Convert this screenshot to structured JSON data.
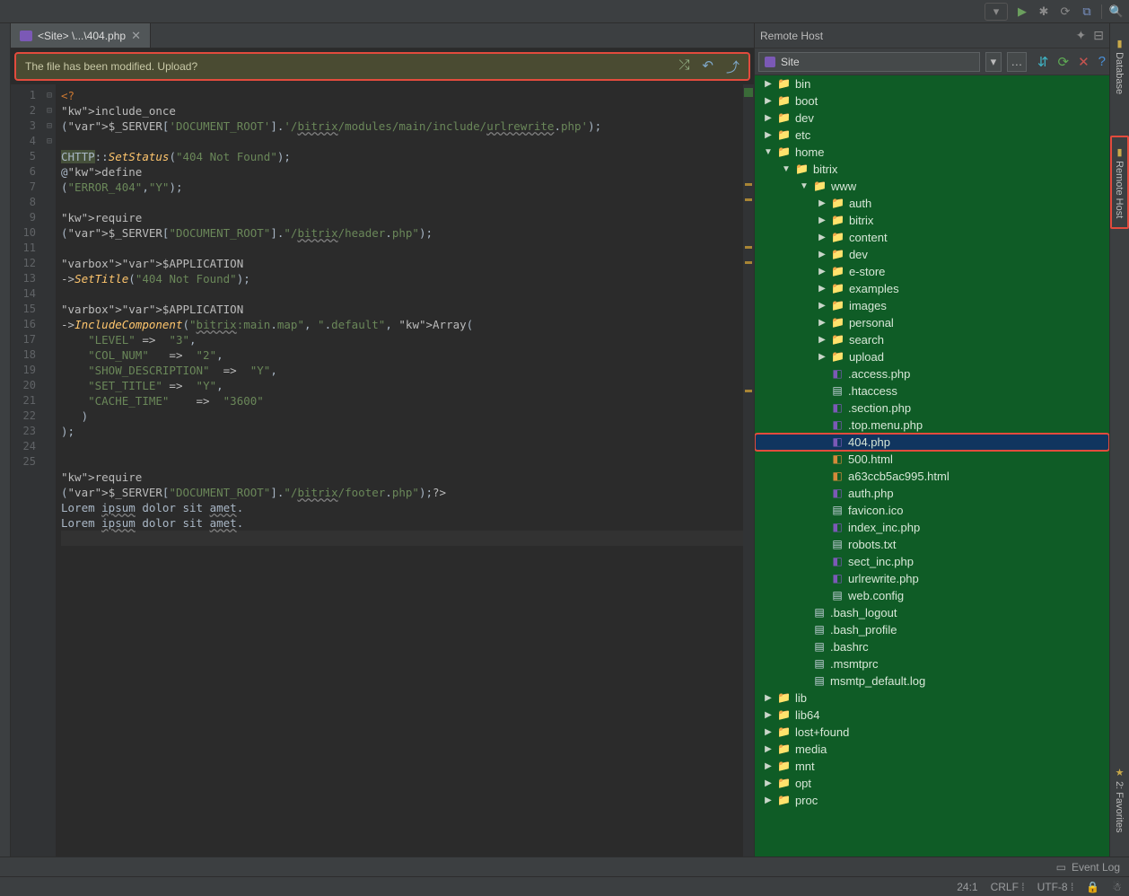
{
  "tab": {
    "label": "<Site> \\...\\404.php"
  },
  "notification": {
    "text": "The file has been modified. Upload?"
  },
  "code_lines": [
    "<?",
    "include_once($_SERVER['DOCUMENT_ROOT'].'/bitrix/modules/main/include/urlrewrite.php');",
    "",
    "CHTTP::SetStatus(\"404 Not Found\");",
    "@define(\"ERROR_404\",\"Y\");",
    "",
    "require($_SERVER[\"DOCUMENT_ROOT\"].\"/bitrix/header.php\");",
    "",
    "$APPLICATION->SetTitle(\"404 Not Found\");",
    "",
    "$APPLICATION->IncludeComponent(\"bitrix:main.map\", \".default\", Array(",
    "    \"LEVEL\" =>  \"3\",",
    "    \"COL_NUM\"   =>  \"2\",",
    "    \"SHOW_DESCRIPTION\"  =>  \"Y\",",
    "    \"SET_TITLE\" =>  \"Y\",",
    "    \"CACHE_TIME\"    =>  \"3600\"",
    "   )",
    ");",
    "",
    "",
    "require($_SERVER[\"DOCUMENT_ROOT\"].\"/bitrix/footer.php\");?>",
    "Lorem ipsum dolor sit amet.",
    "Lorem ipsum dolor sit amet.",
    "",
    ""
  ],
  "remote_host": {
    "title": "Remote Host"
  },
  "deployment": {
    "name": "Site"
  },
  "tree": [
    {
      "d": 0,
      "exp": false,
      "type": "folder",
      "name": "bin"
    },
    {
      "d": 0,
      "exp": false,
      "type": "folder",
      "name": "boot"
    },
    {
      "d": 0,
      "exp": false,
      "type": "folder",
      "name": "dev"
    },
    {
      "d": 0,
      "exp": false,
      "type": "folder",
      "name": "etc"
    },
    {
      "d": 0,
      "exp": true,
      "type": "folder",
      "name": "home"
    },
    {
      "d": 1,
      "exp": true,
      "type": "folder",
      "name": "bitrix"
    },
    {
      "d": 2,
      "exp": true,
      "type": "folder",
      "name": "www"
    },
    {
      "d": 3,
      "exp": false,
      "type": "folder",
      "name": "auth"
    },
    {
      "d": 3,
      "exp": false,
      "type": "folder",
      "name": "bitrix"
    },
    {
      "d": 3,
      "exp": false,
      "type": "folder",
      "name": "content"
    },
    {
      "d": 3,
      "exp": false,
      "type": "folder",
      "name": "dev"
    },
    {
      "d": 3,
      "exp": false,
      "type": "folder",
      "name": "e-store"
    },
    {
      "d": 3,
      "exp": false,
      "type": "folder",
      "name": "examples"
    },
    {
      "d": 3,
      "exp": false,
      "type": "folder",
      "name": "images"
    },
    {
      "d": 3,
      "exp": false,
      "type": "folder",
      "name": "personal"
    },
    {
      "d": 3,
      "exp": false,
      "type": "folder",
      "name": "search"
    },
    {
      "d": 3,
      "exp": false,
      "type": "folder",
      "name": "upload"
    },
    {
      "d": 3,
      "type": "file",
      "ft": "php",
      "name": ".access.php"
    },
    {
      "d": 3,
      "type": "file",
      "ft": "txt",
      "name": ".htaccess"
    },
    {
      "d": 3,
      "type": "file",
      "ft": "php",
      "name": ".section.php"
    },
    {
      "d": 3,
      "type": "file",
      "ft": "php",
      "name": ".top.menu.php"
    },
    {
      "d": 3,
      "type": "file",
      "ft": "php",
      "name": "404.php",
      "sel": true,
      "hl": true
    },
    {
      "d": 3,
      "type": "file",
      "ft": "html",
      "name": "500.html"
    },
    {
      "d": 3,
      "type": "file",
      "ft": "html",
      "name": "a63ccb5ac995.html"
    },
    {
      "d": 3,
      "type": "file",
      "ft": "php",
      "name": "auth.php"
    },
    {
      "d": 3,
      "type": "file",
      "ft": "txt",
      "name": "favicon.ico"
    },
    {
      "d": 3,
      "type": "file",
      "ft": "php",
      "name": "index_inc.php"
    },
    {
      "d": 3,
      "type": "file",
      "ft": "txt",
      "name": "robots.txt"
    },
    {
      "d": 3,
      "type": "file",
      "ft": "php",
      "name": "sect_inc.php"
    },
    {
      "d": 3,
      "type": "file",
      "ft": "php",
      "name": "urlrewrite.php"
    },
    {
      "d": 3,
      "type": "file",
      "ft": "txt",
      "name": "web.config"
    },
    {
      "d": 2,
      "type": "file",
      "ft": "txt",
      "name": ".bash_logout"
    },
    {
      "d": 2,
      "type": "file",
      "ft": "txt",
      "name": ".bash_profile"
    },
    {
      "d": 2,
      "type": "file",
      "ft": "txt",
      "name": ".bashrc"
    },
    {
      "d": 2,
      "type": "file",
      "ft": "txt",
      "name": ".msmtprc"
    },
    {
      "d": 2,
      "type": "file",
      "ft": "txt",
      "name": "msmtp_default.log"
    },
    {
      "d": 0,
      "exp": false,
      "type": "folder",
      "name": "lib"
    },
    {
      "d": 0,
      "exp": false,
      "type": "folder",
      "name": "lib64"
    },
    {
      "d": 0,
      "exp": false,
      "type": "folder",
      "name": "lost+found"
    },
    {
      "d": 0,
      "exp": false,
      "type": "folder",
      "name": "media"
    },
    {
      "d": 0,
      "exp": false,
      "type": "folder",
      "name": "mnt"
    },
    {
      "d": 0,
      "exp": false,
      "type": "folder",
      "name": "opt"
    },
    {
      "d": 0,
      "exp": false,
      "type": "folder",
      "name": "proc"
    }
  ],
  "rail": {
    "database": "Database",
    "remote": "Remote Host",
    "favorites": "2: Favorites"
  },
  "eventlog": "Event Log",
  "status": {
    "pos": "24:1",
    "eol": "CRLF",
    "enc": "UTF-8"
  }
}
